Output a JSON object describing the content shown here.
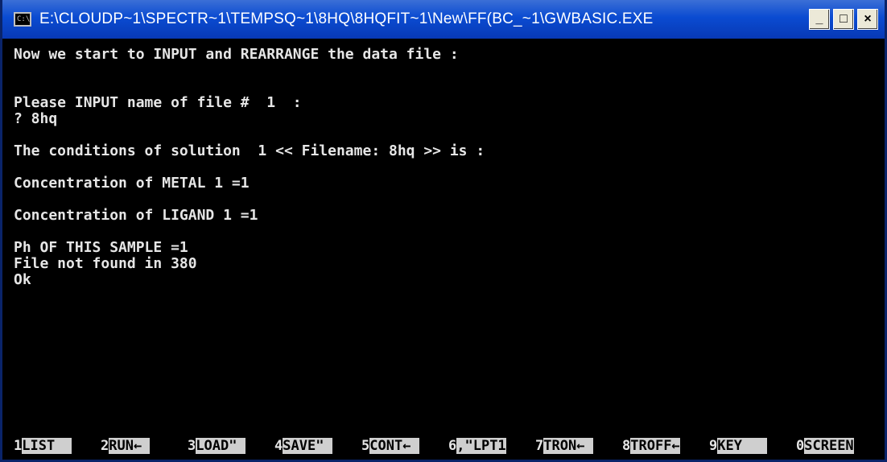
{
  "window": {
    "title": "E:\\CLOUDP~1\\SPECTR~1\\TEMPSQ~1\\8HQ\\8HQFIT~1\\New\\FF(BC_~1\\GWBASIC.EXE",
    "icon_glyph": "C:\\",
    "minimize_label": "_",
    "maximize_label": "□",
    "close_label": "×"
  },
  "console": {
    "lines": [
      "Now we start to INPUT and REARRANGE the data file :",
      "Please INPUT name of file #  1  :",
      "? 8hq",
      "The conditions of solution  1 << Filename: 8hq >> is :",
      "Concentration of METAL 1 =1",
      "Concentration of LIGAND 1 =1",
      "Ph OF THIS SAMPLE =1",
      "File not found in 380",
      "Ok"
    ]
  },
  "function_keys": [
    {
      "num": "1",
      "label": "LIST  "
    },
    {
      "num": "2",
      "label": "RUN← "
    },
    {
      "num": "3",
      "label": "LOAD\" "
    },
    {
      "num": "4",
      "label": "SAVE\" "
    },
    {
      "num": "5",
      "label": "CONT← "
    },
    {
      "num": "6",
      "label": ",\"LPT1"
    },
    {
      "num": "7",
      "label": "TRON← "
    },
    {
      "num": "8",
      "label": "TROFF←"
    },
    {
      "num": "9",
      "label": "KEY   "
    },
    {
      "num": "0",
      "label": "SCREEN"
    }
  ],
  "colors": {
    "titlebar": "#0a4bd1",
    "console_bg": "#000000",
    "console_fg": "#e6e6e6"
  }
}
